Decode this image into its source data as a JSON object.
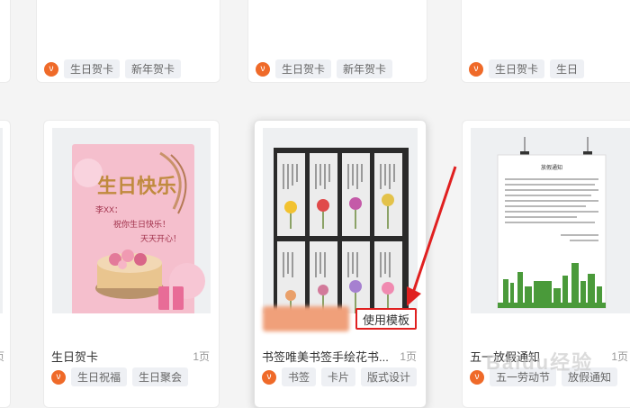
{
  "top_row": [
    {
      "tags": [
        "生日贺卡",
        "新年贺卡"
      ]
    },
    {
      "tags": [
        "生日贺卡",
        "新年贺卡"
      ]
    },
    {
      "tags": [
        "生日贺卡",
        "生日"
      ]
    }
  ],
  "cards": [
    {
      "title": "生日贺卡",
      "pages": "1页",
      "tags": [
        "生日祝福",
        "生日聚会"
      ],
      "thumb": {
        "heading": "生日快乐",
        "name_line": "李XX：",
        "wish_line1": "祝你生日快乐！",
        "wish_line2": "天天开心！"
      }
    },
    {
      "title": "书签唯美书签手绘花书...",
      "pages": "1页",
      "tags": [
        "书签",
        "卡片",
        "版式设计"
      ],
      "use_button": "使用模板"
    },
    {
      "title": "五一放假通知",
      "pages": "1页",
      "tags": [
        "五一劳动节",
        "放假通知"
      ],
      "thumb": {
        "heading": "放假通知"
      }
    }
  ],
  "left_partial": {
    "pages": "页"
  },
  "watermark": "Baidu经验",
  "colors": {
    "accent_orange": "#ef6a29",
    "highlight_red": "#e02020",
    "pink": "#f3b6c8",
    "green": "#4a9a3a"
  }
}
